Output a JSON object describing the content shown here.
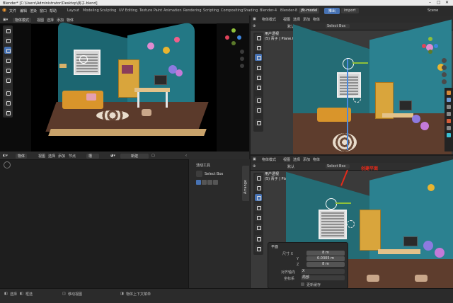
{
  "titlebar": {
    "title": "Blender* [C:\\Users\\Administrator\\Desktop\\房子.blend]"
  },
  "menu": {
    "file": "文件",
    "edit": "编辑",
    "render": "渲染",
    "window": "窗口",
    "help": "帮助"
  },
  "workspaces": [
    "Layout",
    "Modeling",
    "Sculpting",
    "UV Editing",
    "Texture Paint",
    "Animation",
    "Rendering",
    "Scripting",
    "Compositing",
    "Shading",
    "Blender-4",
    "Blender-8",
    "jfk-model"
  ],
  "topright": {
    "btn1": "推出",
    "btn2": "import",
    "scene": "Scene"
  },
  "viewport_right_top": {
    "mode": "物体模式",
    "view": "视图",
    "select": "选择",
    "add": "添加",
    "object": "物体",
    "orientation": "默认",
    "select_box": "Select Box",
    "options": "选项",
    "view_title": "用户透视",
    "view_sub": "(5) 青子 | Plane.003"
  },
  "viewport_right_bottom": {
    "mode": "物体模式",
    "view": "视图",
    "select": "选择",
    "add": "添加",
    "object": "物体",
    "orientation": "默认",
    "select_box": "Select Box",
    "options": "选项",
    "view_title": "用户透视",
    "view_sub": "(5) 青子 | Plane.003",
    "annotation": "创建平面"
  },
  "viewport_left": {
    "mode": "物体模式",
    "view": "视图",
    "select": "选择",
    "add": "添加",
    "object": "物体"
  },
  "node_editor": {
    "mode": "物体",
    "view": "视图",
    "select": "选择",
    "add": "添加",
    "node": "节点",
    "slot": "槽",
    "new_btn": "新建"
  },
  "active_tool": {
    "title": "活动工具",
    "tool": "Select Box",
    "side_tab": "Arrange"
  },
  "redo_panel": {
    "title": "平面",
    "size_label": "尺寸 X",
    "size_value": "8 m",
    "y_label": "Y",
    "y_value": "0.0305 m",
    "z_label": "Z",
    "z_value": "8 m",
    "align_label": "对齐轴向",
    "align_value": "X",
    "coord_label": "坐标系",
    "coord_value": "局部",
    "checkbox_label": "更新缓存"
  },
  "statusbar": {
    "item1": "选择",
    "item2": "框选",
    "item3": "移动视图",
    "item4": "物体上下文菜单"
  },
  "colors": {
    "accent": "#4772b3",
    "annotation": "#e52a1a",
    "wall": "#1f6f7a",
    "viewport_bg": "#3a3a3a"
  }
}
